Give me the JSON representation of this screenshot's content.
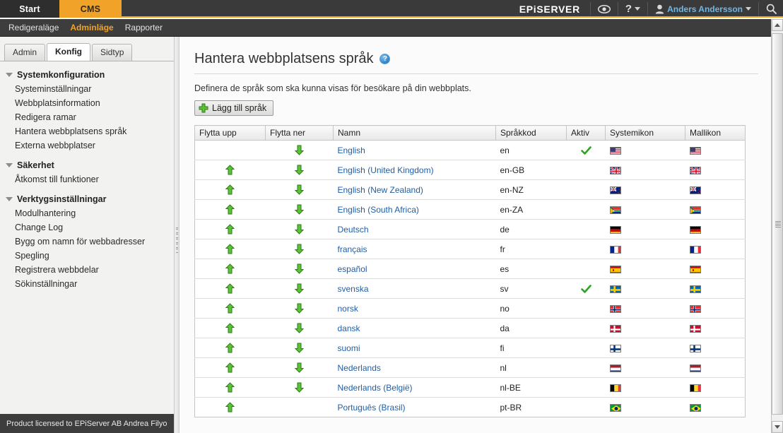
{
  "topbar": {
    "tabs": [
      {
        "label": "Start",
        "active": false
      },
      {
        "label": "CMS",
        "active": true
      }
    ],
    "logo": "EPiSERVER",
    "eye_icon": "eye-icon",
    "help_label": "?",
    "user_name": "Anders Andersson",
    "search_icon": "search-icon",
    "accent_color": "#f0a229"
  },
  "menubar": {
    "items": [
      {
        "label": "Redigeraläge",
        "active": false
      },
      {
        "label": "Adminläge",
        "active": true
      },
      {
        "label": "Rapporter",
        "active": false
      }
    ]
  },
  "sidebar": {
    "tabs": [
      {
        "label": "Admin",
        "active": false
      },
      {
        "label": "Konfig",
        "active": true
      },
      {
        "label": "Sidtyp",
        "active": false
      }
    ],
    "groups": [
      {
        "title": "Systemkonfiguration",
        "items": [
          "Systeminställningar",
          "Webbplatsinformation",
          "Redigera ramar",
          "Hantera webbplatsens språk",
          "Externa webbplatser"
        ]
      },
      {
        "title": "Säkerhet",
        "items": [
          "Åtkomst till funktioner"
        ]
      },
      {
        "title": "Verktygsinställningar",
        "items": [
          "Modulhantering",
          "Change Log",
          "Bygg om namn för webbadresser",
          "Spegling",
          "Registrera webbdelar",
          "Sökinställningar"
        ]
      }
    ],
    "license": "Product licensed to EPiServer AB Andrea Filyo"
  },
  "main": {
    "title": "Hantera webbplatsens språk",
    "help_icon": "help-icon",
    "help_glyph": "?",
    "subtitle": "Definera de språk som ska kunna visas för besökare på din webbplats.",
    "add_button": "Lägg till språk",
    "add_icon": "plus-icon",
    "table": {
      "columns": [
        "Flytta upp",
        "Flytta ner",
        "Namn",
        "Språkkod",
        "Aktiv",
        "Systemikon",
        "Mallikon"
      ],
      "rows": [
        {
          "up": false,
          "down": true,
          "name": "English",
          "code": "en",
          "active": true,
          "flag": "us"
        },
        {
          "up": true,
          "down": true,
          "name": "English (United Kingdom)",
          "code": "en-GB",
          "active": false,
          "flag": "gb"
        },
        {
          "up": true,
          "down": true,
          "name": "English (New Zealand)",
          "code": "en-NZ",
          "active": false,
          "flag": "nz"
        },
        {
          "up": true,
          "down": true,
          "name": "English (South Africa)",
          "code": "en-ZA",
          "active": false,
          "flag": "za"
        },
        {
          "up": true,
          "down": true,
          "name": "Deutsch",
          "code": "de",
          "active": false,
          "flag": "de"
        },
        {
          "up": true,
          "down": true,
          "name": "français",
          "code": "fr",
          "active": false,
          "flag": "fr"
        },
        {
          "up": true,
          "down": true,
          "name": "español",
          "code": "es",
          "active": false,
          "flag": "es"
        },
        {
          "up": true,
          "down": true,
          "name": "svenska",
          "code": "sv",
          "active": true,
          "flag": "se"
        },
        {
          "up": true,
          "down": true,
          "name": "norsk",
          "code": "no",
          "active": false,
          "flag": "no"
        },
        {
          "up": true,
          "down": true,
          "name": "dansk",
          "code": "da",
          "active": false,
          "flag": "dk"
        },
        {
          "up": true,
          "down": true,
          "name": "suomi",
          "code": "fi",
          "active": false,
          "flag": "fi"
        },
        {
          "up": true,
          "down": true,
          "name": "Nederlands",
          "code": "nl",
          "active": false,
          "flag": "nl"
        },
        {
          "up": true,
          "down": true,
          "name": "Nederlands (België)",
          "code": "nl-BE",
          "active": false,
          "flag": "be"
        },
        {
          "up": true,
          "down": false,
          "name": "Português (Brasil)",
          "code": "pt-BR",
          "active": false,
          "flag": "br"
        }
      ]
    }
  },
  "scrollbar": {
    "up_icon": "scroll-up-icon",
    "down_icon": "scroll-down-icon"
  }
}
